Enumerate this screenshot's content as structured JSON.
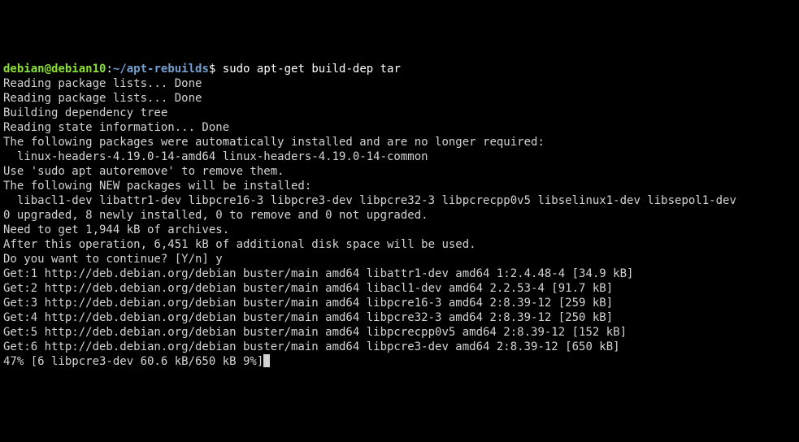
{
  "prompt": {
    "user": "debian",
    "at": "@",
    "host": "debian10",
    "sep": ":",
    "path": "~/apt-rebuilds",
    "end": "$ ",
    "command": "sudo apt-get build-dep tar"
  },
  "lines": [
    "Reading package lists... Done",
    "Reading package lists... Done",
    "Building dependency tree",
    "Reading state information... Done",
    "The following packages were automatically installed and are no longer required:",
    "  linux-headers-4.19.0-14-amd64 linux-headers-4.19.0-14-common",
    "Use 'sudo apt autoremove' to remove them.",
    "The following NEW packages will be installed:",
    "  libacl1-dev libattr1-dev libpcre16-3 libpcre3-dev libpcre32-3 libpcrecpp0v5 libselinux1-dev libsepol1-dev",
    "0 upgraded, 8 newly installed, 0 to remove and 0 not upgraded.",
    "Need to get 1,944 kB of archives.",
    "After this operation, 6,451 kB of additional disk space will be used.",
    "Do you want to continue? [Y/n] y",
    "Get:1 http://deb.debian.org/debian buster/main amd64 libattr1-dev amd64 1:2.4.48-4 [34.9 kB]",
    "Get:2 http://deb.debian.org/debian buster/main amd64 libacl1-dev amd64 2.2.53-4 [91.7 kB]",
    "Get:3 http://deb.debian.org/debian buster/main amd64 libpcre16-3 amd64 2:8.39-12 [259 kB]",
    "Get:4 http://deb.debian.org/debian buster/main amd64 libpcre32-3 amd64 2:8.39-12 [250 kB]",
    "Get:5 http://deb.debian.org/debian buster/main amd64 libpcrecpp0v5 amd64 2:8.39-12 [152 kB]",
    "Get:6 http://deb.debian.org/debian buster/main amd64 libpcre3-dev amd64 2:8.39-12 [650 kB]"
  ],
  "progress": "47% [6 libpcre3-dev 60.6 kB/650 kB 9%]"
}
